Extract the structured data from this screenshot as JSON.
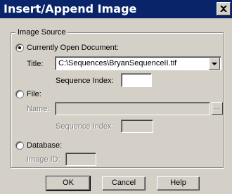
{
  "window": {
    "title": "Insert/Append Image",
    "close_label": "close"
  },
  "image_source": {
    "group_label": "Image Source",
    "selected": "currently_open_document",
    "currently_open_document": {
      "label": "Currently Open Document:",
      "title_label": "Title:",
      "title_value": "C:\\Sequences\\BryanSequenceII.tif",
      "sequence_index_label": "Sequence Index:",
      "sequence_index_value": ""
    },
    "file": {
      "label": "File:",
      "name_label": "Name:",
      "name_value": "",
      "browse_label": "...",
      "sequence_index_label": "Sequence Index:",
      "sequence_index_value": ""
    },
    "database": {
      "label": "Database:",
      "image_id_label": "Image ID:",
      "image_id_value": ""
    }
  },
  "buttons": {
    "ok": "OK",
    "cancel": "Cancel",
    "help": "Help"
  }
}
